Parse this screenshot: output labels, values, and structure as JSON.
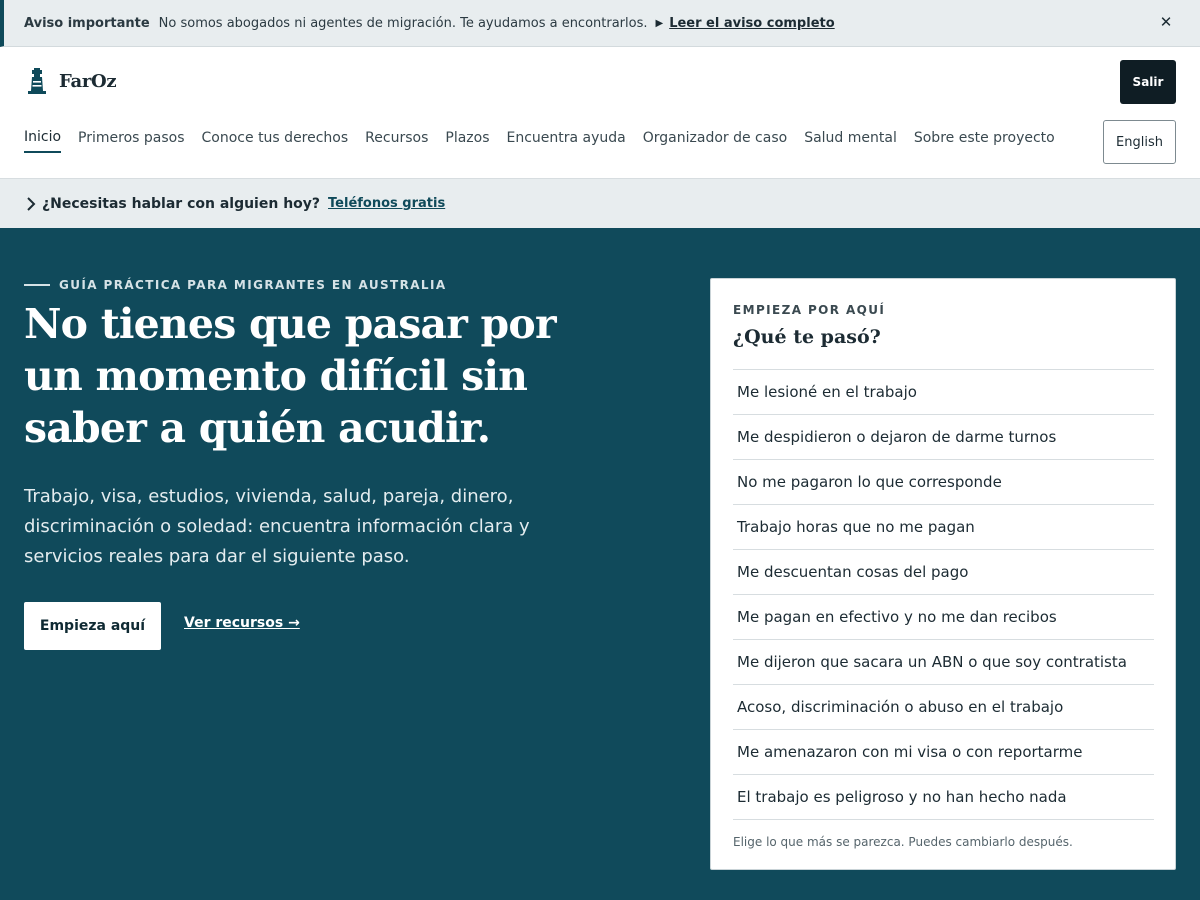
{
  "notice": {
    "label": "Aviso importante",
    "text": "No somos abogados ni agentes de migración. Te ayudamos a encontrarlos.",
    "disclosure_icon": "triangle-right",
    "link": "Leer el aviso completo",
    "close_icon": "close-x"
  },
  "header": {
    "brand": "FarOz",
    "logo_icon": "lighthouse",
    "exit_button": "Salir",
    "nav": [
      {
        "label": "Inicio",
        "active": true
      },
      {
        "label": "Primeros pasos"
      },
      {
        "label": "Conoce tus derechos"
      },
      {
        "label": "Recursos"
      },
      {
        "label": "Plazos"
      },
      {
        "label": "Encuentra ayuda"
      },
      {
        "label": "Organizador de caso"
      },
      {
        "label": "Salud mental"
      },
      {
        "label": "Sobre este proyecto"
      }
    ],
    "language_button": "English"
  },
  "helpbar": {
    "icon": "chevron-right",
    "question": "¿Necesitas hablar con alguien hoy?",
    "link": "Teléfonos gratis"
  },
  "hero": {
    "eyebrow": "GUÍA PRÁCTICA PARA MIGRANTES EN AUSTRALIA",
    "title": "No tienes que pasar por un momento difícil sin saber a quién acudir.",
    "description": "Trabajo, visa, estudios, vivienda, salud, pareja, dinero, discriminación o soledad: encuentra información clara y servicios reales para dar el siguiente paso.",
    "primary_cta": "Empieza aquí",
    "secondary_cta": "Ver recursos →"
  },
  "card": {
    "eyebrow": "EMPIEZA POR AQUÍ",
    "title": "¿Qué te pasó?",
    "options": [
      "Me lesioné en el trabajo",
      "Me despidieron o dejaron de darme turnos",
      "No me pagaron lo que corresponde",
      "Trabajo horas que no me pagan",
      "Me descuentan cosas del pago",
      "Me pagan en efectivo y no me dan recibos",
      "Me dijeron que sacara un ABN o que soy contratista",
      "Acoso, discriminación o abuso en el trabajo",
      "Me amenazaron con mi visa o con reportarme",
      "El trabajo es peligroso y no han hecho nada"
    ],
    "hint": "Elige lo que más se parezca. Puedes cambiarlo después."
  },
  "colors": {
    "hero_bg": "#104a5b",
    "dark_button": "#0f1d24",
    "light_band": "#e8edef",
    "accent": "#0f4a5a"
  }
}
